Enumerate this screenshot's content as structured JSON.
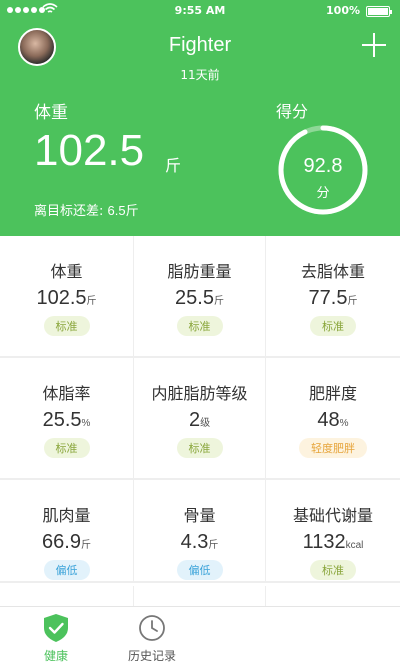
{
  "status_bar": {
    "time": "9:55 AM",
    "battery": "100%"
  },
  "header": {
    "user_name": "Fighter",
    "subtitle": "11天前",
    "weight_label": "体重",
    "weight_value": "102.5",
    "weight_unit": "斤",
    "diff_label": "离目标还差:",
    "diff_value": "6.5斤",
    "score_label": "得分",
    "score_value": "92.8",
    "score_unit": "分",
    "score_progress": 0.928,
    "bg_color": "#4cc25c"
  },
  "metrics": [
    [
      {
        "label": "体重",
        "value": "102.5",
        "unit": "斤",
        "badge": "标准"
      },
      {
        "label": "脂肪重量",
        "value": "25.5",
        "unit": "斤",
        "badge": "标准"
      },
      {
        "label": "去脂体重",
        "value": "77.5",
        "unit": "斤",
        "badge": "标准"
      }
    ],
    [
      {
        "label": "体脂率",
        "value": "25.5",
        "unit": "%",
        "badge": "标准"
      },
      {
        "label": "内脏脂肪等级",
        "value": "2",
        "unit": "级",
        "badge": "标准"
      },
      {
        "label": "肥胖度",
        "value": "48",
        "unit": "%",
        "badge": "轻度肥胖"
      }
    ],
    [
      {
        "label": "肌肉量",
        "value": "66.9",
        "unit": "斤",
        "badge": "偏低"
      },
      {
        "label": "骨量",
        "value": "4.3",
        "unit": "斤",
        "badge": "偏低"
      },
      {
        "label": "基础代谢量",
        "value": "1132",
        "unit": "kcal",
        "badge": "标准"
      }
    ]
  ],
  "tabbar": {
    "health_label": "健康",
    "history_label": "历史记录",
    "active_color": "#4cc25c",
    "health_icon": "shield-check-icon",
    "history_icon": "clock-icon"
  }
}
